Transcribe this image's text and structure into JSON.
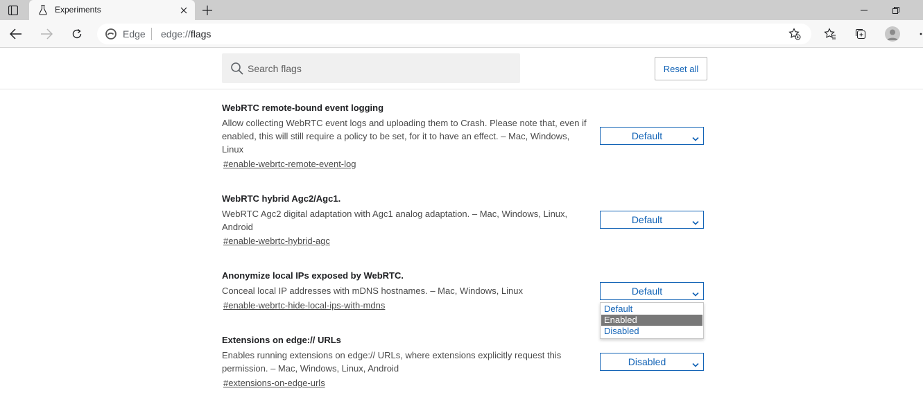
{
  "colors": {
    "accent": "#1263b6",
    "tabstrip": "#cdcdcd",
    "toolbar": "#f7f7f7",
    "highlight_option": "#787878"
  },
  "browser": {
    "tab": {
      "title": "Experiments",
      "favicon": "beaker-icon"
    },
    "omnibox": {
      "site_name": "Edge",
      "url_scheme": "edge://",
      "url_host": "flags"
    }
  },
  "flags_header": {
    "search_placeholder": "Search flags",
    "search_value": "",
    "reset_label": "Reset all"
  },
  "experiments": [
    {
      "title": "WebRTC remote-bound event logging",
      "description": "Allow collecting WebRTC event logs and uploading them to Crash. Please note that, even if enabled, this will still require a policy to be set, for it to have an effect. – Mac, Windows, Linux",
      "link": "#enable-webrtc-remote-event-log",
      "value": "Default"
    },
    {
      "title": "WebRTC hybrid Agc2/Agc1.",
      "description": "WebRTC Agc2 digital adaptation with Agc1 analog adaptation. – Mac, Windows, Linux, Android",
      "link": "#enable-webrtc-hybrid-agc",
      "value": "Default"
    },
    {
      "title": "Anonymize local IPs exposed by WebRTC.",
      "description": "Conceal local IP addresses with mDNS hostnames. – Mac, Windows, Linux",
      "link": "#enable-webrtc-hide-local-ips-with-mdns",
      "value": "Default"
    },
    {
      "title": "Extensions on edge:// URLs",
      "description": "Enables running extensions on edge:// URLs, where extensions explicitly request this permission. – Mac, Windows, Linux, Android",
      "link": "#extensions-on-edge-urls",
      "value": "Disabled"
    }
  ],
  "open_dropdown": {
    "options": [
      "Default",
      "Enabled",
      "Disabled"
    ],
    "highlighted": "Enabled"
  }
}
